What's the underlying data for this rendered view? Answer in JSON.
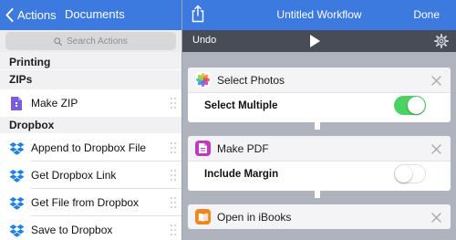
{
  "left_nav": {
    "back_label": "Actions",
    "docs_label": "Documents"
  },
  "search": {
    "placeholder": "Search Actions"
  },
  "sections": {
    "printing": "Printing",
    "zips": "ZIPs",
    "dropbox": "Dropbox"
  },
  "actions": {
    "make_zip": "Make ZIP",
    "append_dropbox": "Append to Dropbox File",
    "get_dropbox_link": "Get Dropbox Link",
    "get_file_dropbox": "Get File from Dropbox",
    "save_dropbox": "Save to Dropbox"
  },
  "workflow_nav": {
    "title": "Untitled Workflow",
    "done_label": "Done"
  },
  "toolbar": {
    "undo_label": "Undo"
  },
  "cards": [
    {
      "title": "Select Photos",
      "icon": "photos-icon",
      "param_label": "Select Multiple",
      "param_on": true
    },
    {
      "title": "Make PDF",
      "icon": "pdf-icon",
      "param_label": "Include Margin",
      "param_on": false
    },
    {
      "title": "Open in iBooks",
      "icon": "ibooks-icon"
    }
  ],
  "colors": {
    "nav_blue": "#3c7ae0",
    "toolbar_dark": "#474c57",
    "canvas_gray": "#aeb3bd",
    "toggle_green": "#4ad264",
    "dropbox_blue": "#1f81e0",
    "pdf_magenta": "#c238c4",
    "ibooks_orange": "#f0861e"
  }
}
